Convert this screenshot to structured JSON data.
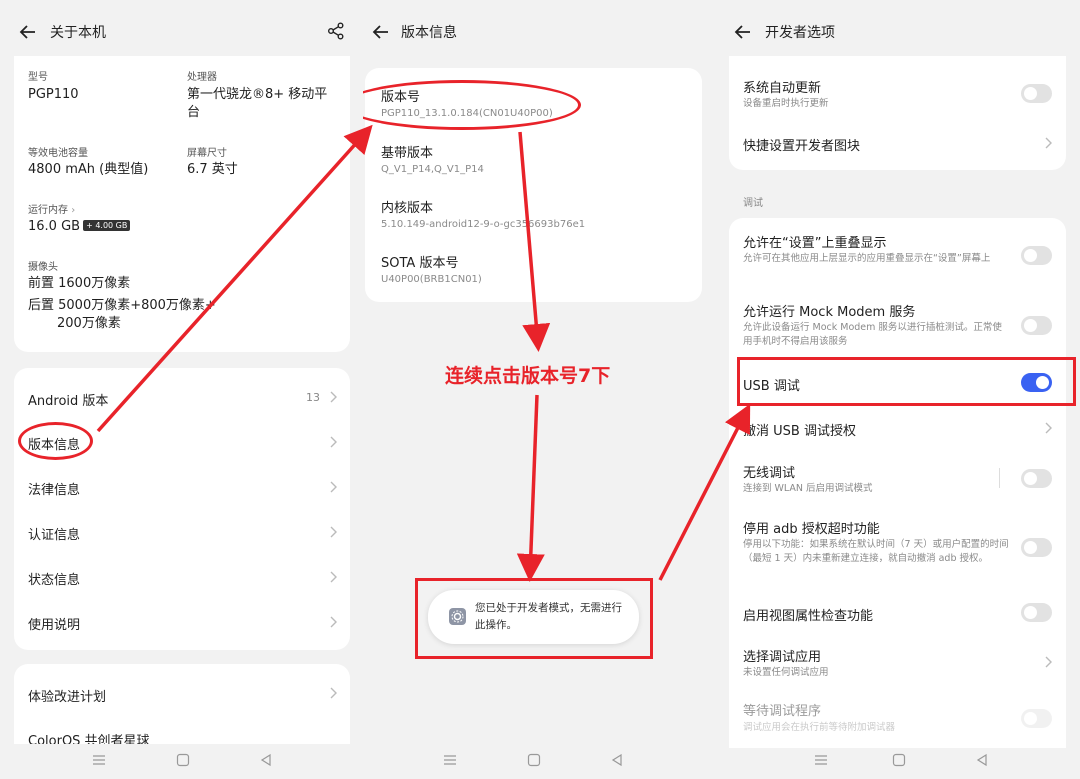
{
  "panel1": {
    "title": "关于本机",
    "specs": {
      "model_label": "型号",
      "model_value": "PGP110",
      "cpu_label": "处理器",
      "cpu_value_1": "第一代骁龙®8+ 移动平",
      "cpu_value_2": "台",
      "battery_label": "等效电池容量",
      "battery_value": "4800 mAh (典型值)",
      "screen_label": "屏幕尺寸",
      "screen_value": "6.7 英寸",
      "ram_label": "运行内存",
      "ram_value": "16.0 GB",
      "ram_badge": "+ 4.00 GB",
      "camera_label": "摄像头",
      "camera_front": "前置 1600万像素",
      "camera_rear_1": "后置 5000万像素+800万像素+",
      "camera_rear_2": "200万像素"
    },
    "menu": [
      {
        "label": "Android 版本",
        "value": "13"
      },
      {
        "label": "版本信息",
        "value": ""
      },
      {
        "label": "法律信息",
        "value": ""
      },
      {
        "label": "认证信息",
        "value": ""
      },
      {
        "label": "状态信息",
        "value": ""
      },
      {
        "label": "使用说明",
        "value": ""
      }
    ],
    "menu2": [
      {
        "label": "体验改进计划"
      },
      {
        "label": "ColorOS 共创者星球"
      }
    ]
  },
  "panel2": {
    "title": "版本信息",
    "items": [
      {
        "title": "版本号",
        "sub": "PGP110_13.1.0.184(CN01U40P00)"
      },
      {
        "title": "基带版本",
        "sub": "Q_V1_P14,Q_V1_P14"
      },
      {
        "title": "内核版本",
        "sub": "5.10.149-android12-9-o-gc35669​3b76e1"
      },
      {
        "title": "SOTA 版本号",
        "sub": "U40P00(BRB1CN01)"
      }
    ],
    "annotation": "连续点击版本号7下",
    "toast": "您已处于开发者模式，无需进行此操作。"
  },
  "panel3": {
    "title": "开发者选项",
    "top": [
      {
        "title": "系统自动更新",
        "sub": "设备重启时执行更新"
      },
      {
        "title": "快捷设置开发者图块",
        "sub": ""
      }
    ],
    "section": "调试",
    "items": [
      {
        "title": "允许在“设置”上重叠显示",
        "sub": "允许可在其他应用上层显示的应用重叠显示在“设置”屏幕上"
      },
      {
        "title": "允许运行 Mock Modem 服务",
        "sub": "允许此设备运行 Mock Modem 服务以进行插桩测试。正常使用手机时不得启用该服务"
      },
      {
        "title": "USB 调试",
        "sub": ""
      },
      {
        "title": "撤消 USB 调试授权",
        "sub": ""
      },
      {
        "title": "无线调试",
        "sub": "连接到 WLAN 后启用调试模式"
      },
      {
        "title": "停用 adb 授权超时功能",
        "sub": "停用以下功能：如果系统在默认时间（7 天）或用户配置的时间（最短 1 天）内未重新建立连接，就自动撤消 adb 授权。"
      },
      {
        "title": "启用视图属性检查功能",
        "sub": ""
      },
      {
        "title": "选择调试应用",
        "sub": "未设置任何调试应用"
      },
      {
        "title": "等待调试程序",
        "sub": "调试应用会在执行前等待附加调试器"
      }
    ],
    "usb_debugging_on": true
  },
  "colors": {
    "accent": "#3a62f2",
    "annotation_red": "#e8232a",
    "background": "#f2f2f2"
  }
}
